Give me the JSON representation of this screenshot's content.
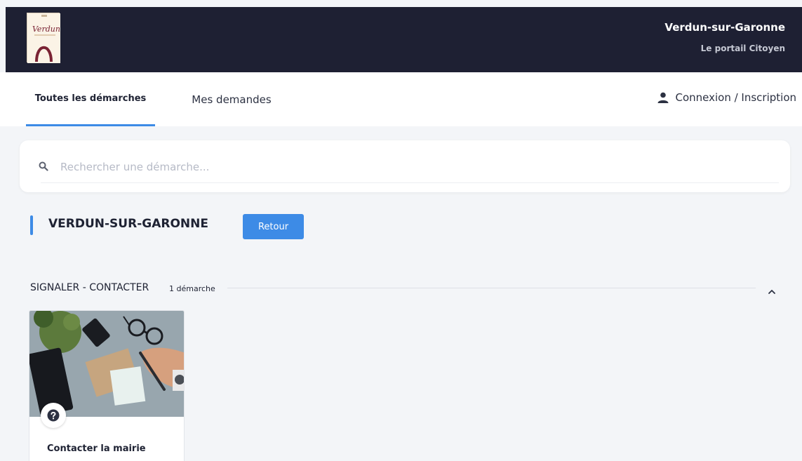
{
  "header": {
    "site_title": "Verdun-sur-Garonne",
    "site_subtitle": "Le portail Citoyen",
    "logo_text": "Verdun"
  },
  "nav": {
    "tabs": [
      {
        "label": "Toutes les démarches",
        "active": true
      },
      {
        "label": "Mes demandes",
        "active": false
      }
    ],
    "login_label": "Connexion / Inscription",
    "login_icon": "user-icon"
  },
  "search": {
    "placeholder": "Rechercher une démarche...",
    "value": "",
    "icon": "search-icon"
  },
  "section": {
    "title": "VERDUN-SUR-GARONNE",
    "back_label": "Retour"
  },
  "category": {
    "title": "SIGNALER - CONTACTER",
    "count": "1 démarche",
    "toggle_icon": "chevron-up-icon",
    "cards": [
      {
        "label": "Contacter la mairie",
        "icon": "question-circle-icon"
      }
    ]
  },
  "colors": {
    "header_bg": "#1e2033",
    "accent": "#3d8be6",
    "page_bg": "#f3f5f8"
  }
}
